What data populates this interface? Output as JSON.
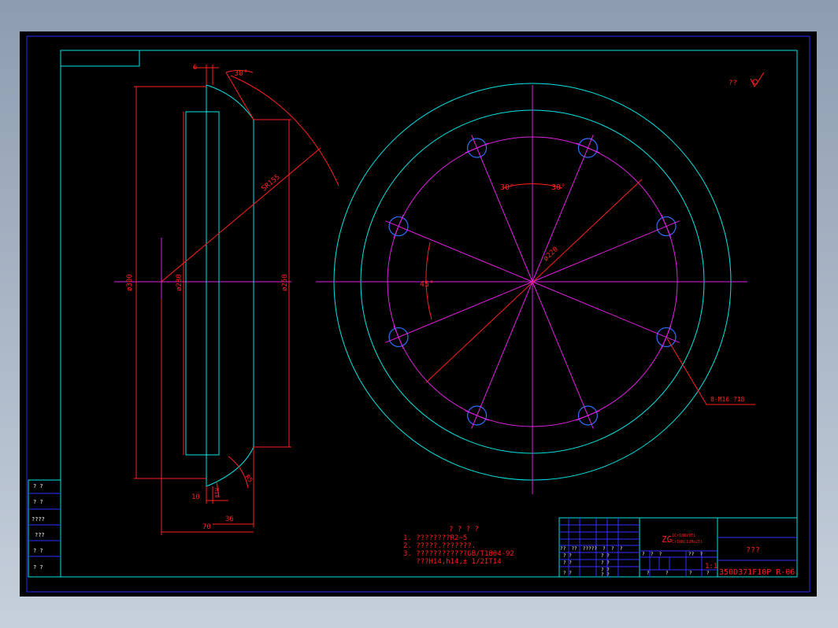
{
  "colors": {
    "background": "#000000",
    "frame": "#2a2aff",
    "border": "#00e5e5",
    "dimension": "#ff2020",
    "centerline": "#e020e0",
    "outline": "#00e5e5",
    "table_grid": "#3030ff",
    "table_text": "#ffffff"
  },
  "side_view": {
    "dims": {
      "top_width": "6",
      "chamfer_angle": "30°",
      "sphere_radius": "SR155",
      "dia_outer": "ø300",
      "dia_inner": "ø280",
      "dia_face": "ø250",
      "bottom_10": "10",
      "bottom_36": "36",
      "bottom_70": "70",
      "radius_r5": "R5",
      "small_dim": "R10"
    }
  },
  "front_view": {
    "dims": {
      "angle_left": "30°",
      "angle_right": "30°",
      "angle_45": "45°",
      "pcd": "ø220",
      "bolt_holes": "8-M16 ?18"
    }
  },
  "roughness_note": "??",
  "notes": {
    "title": "? ? ? ?",
    "lines": [
      "1. ????????R2~5",
      "2. ?????.???????.",
      "3. ????????????GB/T1804-92",
      "   ???H14,h14,± 1/2IT14"
    ]
  },
  "left_table": {
    "rows": [
      "?  ?",
      "?  ?",
      "????",
      "???",
      "?  ?",
      "?  ?"
    ]
  },
  "title_block": {
    "material": "ZG",
    "material_sub1": "1Cr18Ni9Ti",
    "material_sub2": "Cr18Ni12Mo2Ti",
    "part_name": "???",
    "drawing_number": "350D371F10P R-06",
    "scale": "1:1",
    "grid_row_labels": [
      "??  ??  ?????  ?  ?  ?",
      "?  ?",
      "?  ?",
      "?  ?"
    ],
    "grid_mid_labels": [
      "?  ?",
      "?  ?",
      "?  ?",
      "?  ?"
    ],
    "stage_label": "?  ?  ?",
    "stage_right": "??  ?",
    "bottom_labels": [
      "?",
      "?",
      "?",
      "?"
    ]
  }
}
